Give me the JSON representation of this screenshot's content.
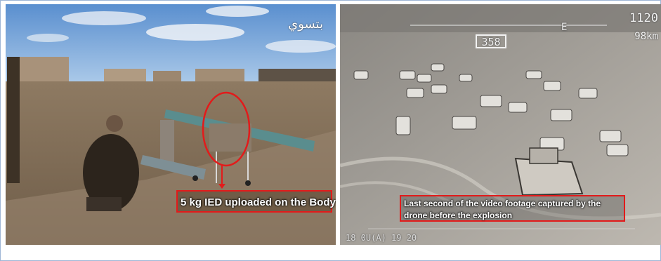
{
  "left_photo": {
    "caption": "5 kg IED uploaded on the Body",
    "watermark": "بتسوي",
    "accent_color": "#e21b1b"
  },
  "right_photo": {
    "caption": "Last second of the video footage captured by the drone before the explosion",
    "hud": {
      "heading": "358",
      "altitude": "1120",
      "speed": "98km",
      "compass": "E",
      "bottom": "18 0U(A) 19 20"
    }
  }
}
